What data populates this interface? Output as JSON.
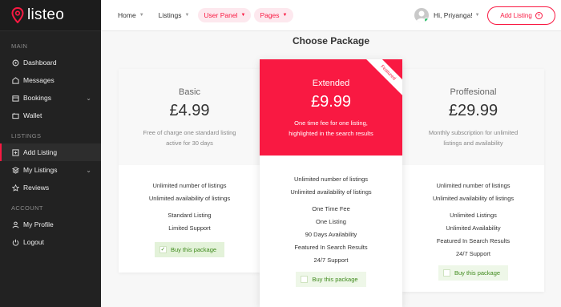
{
  "app": {
    "logo_text": "listeo"
  },
  "sidebar": {
    "sections": [
      {
        "label": "Main"
      },
      {
        "label": "Listings"
      },
      {
        "label": "Account"
      }
    ],
    "items": [
      {
        "label": "Dashboard",
        "icon": "dashboard-icon"
      },
      {
        "label": "Messages",
        "icon": "messages-icon"
      },
      {
        "label": "Bookings",
        "icon": "bookings-icon"
      },
      {
        "label": "Wallet",
        "icon": "wallet-icon"
      },
      {
        "label": "Add Listing",
        "icon": "add-listing-icon"
      },
      {
        "label": "My Listings",
        "icon": "my-listings-icon"
      },
      {
        "label": "Reviews",
        "icon": "star-icon"
      },
      {
        "label": "My Profile",
        "icon": "user-icon"
      },
      {
        "label": "Logout",
        "icon": "power-icon"
      }
    ]
  },
  "header": {
    "nav": [
      {
        "label": "Home"
      },
      {
        "label": "Listings"
      },
      {
        "label": "User Panel"
      },
      {
        "label": "Pages"
      }
    ],
    "user_greeting": "Hi, Priyanga!",
    "add_listing_label": "Add Listing"
  },
  "main": {
    "title": "Choose Package",
    "packages": [
      {
        "name": "Basic",
        "price": "£4.99",
        "desc1": "Free of charge one standard listing",
        "desc2": "active for 30 days",
        "features": [
          "Unlimited number of listings",
          "Unlimited availability of listings",
          "Standard Listing",
          "Limited Support"
        ],
        "button": "Buy this package"
      },
      {
        "name": "Extended",
        "price": "£9.99",
        "desc1": "One time fee for one listing,",
        "desc2": "highlighted in the search results",
        "ribbon": "Featured",
        "features": [
          "Unlimited number of listings",
          "Unlimited availability of listings",
          "One Time Fee",
          "One Listing",
          "90 Days Availability",
          "Featured In Search Results",
          "24/7 Support"
        ],
        "button": "Buy this package"
      },
      {
        "name": "Proffesional",
        "price": "£29.99",
        "desc1": "Monthly subscription for unlimited",
        "desc2": "listings and availability",
        "features": [
          "Unlimited number of listings",
          "Unlimited availability of listings",
          "Unlimited Listings",
          "Unlimited Availability",
          "Featured In Search Results",
          "24/7 Support"
        ],
        "button": "Buy this package"
      }
    ]
  },
  "colors": {
    "accent": "#f91942",
    "sidebar_bg": "#222222",
    "buy_bg": "#e3f2d9",
    "buy_text": "#3f8a1c"
  }
}
